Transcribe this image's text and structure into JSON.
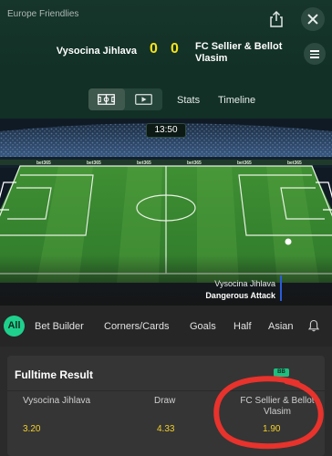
{
  "header": {
    "league": "Europe Friendlies",
    "home_team": "Vysocina Jihlava",
    "away_team_line1": "FC Sellier & Bellot",
    "away_team_line2": "Vlasim",
    "home_score": "0",
    "away_score": "0",
    "icons": [
      "share-icon",
      "close-icon",
      "menu-icon"
    ]
  },
  "media_bar": {
    "tabs": [
      "Stats",
      "Timeline"
    ],
    "icons": [
      "pitch-view-icon",
      "video-play-icon"
    ]
  },
  "pitch": {
    "clock": "13:50",
    "attack_team": "Vysocina Jihlava",
    "attack_status": "Dangerous Attack",
    "board_text": "bet365"
  },
  "market_tabs": {
    "items": [
      "All",
      "Bet Builder",
      "Corners/Cards",
      "Goals",
      "Half",
      "Asian"
    ],
    "active": "All",
    "icons": [
      "bell-icon"
    ]
  },
  "market": {
    "title": "Fulltime Result",
    "badge": "BB",
    "options": [
      {
        "name": "Vysocina Jihlava",
        "price": "3.20"
      },
      {
        "name": "Draw",
        "price": "4.33"
      },
      {
        "name_line1": "FC Sellier & Bellot",
        "name_line2": "Vlasim",
        "price": "1.90"
      }
    ]
  },
  "colors": {
    "accent": "#1fd08c",
    "score": "#f6e21b",
    "odds": "#f3d02a",
    "header_bg": "#123026",
    "annotation": "#e8322c"
  }
}
